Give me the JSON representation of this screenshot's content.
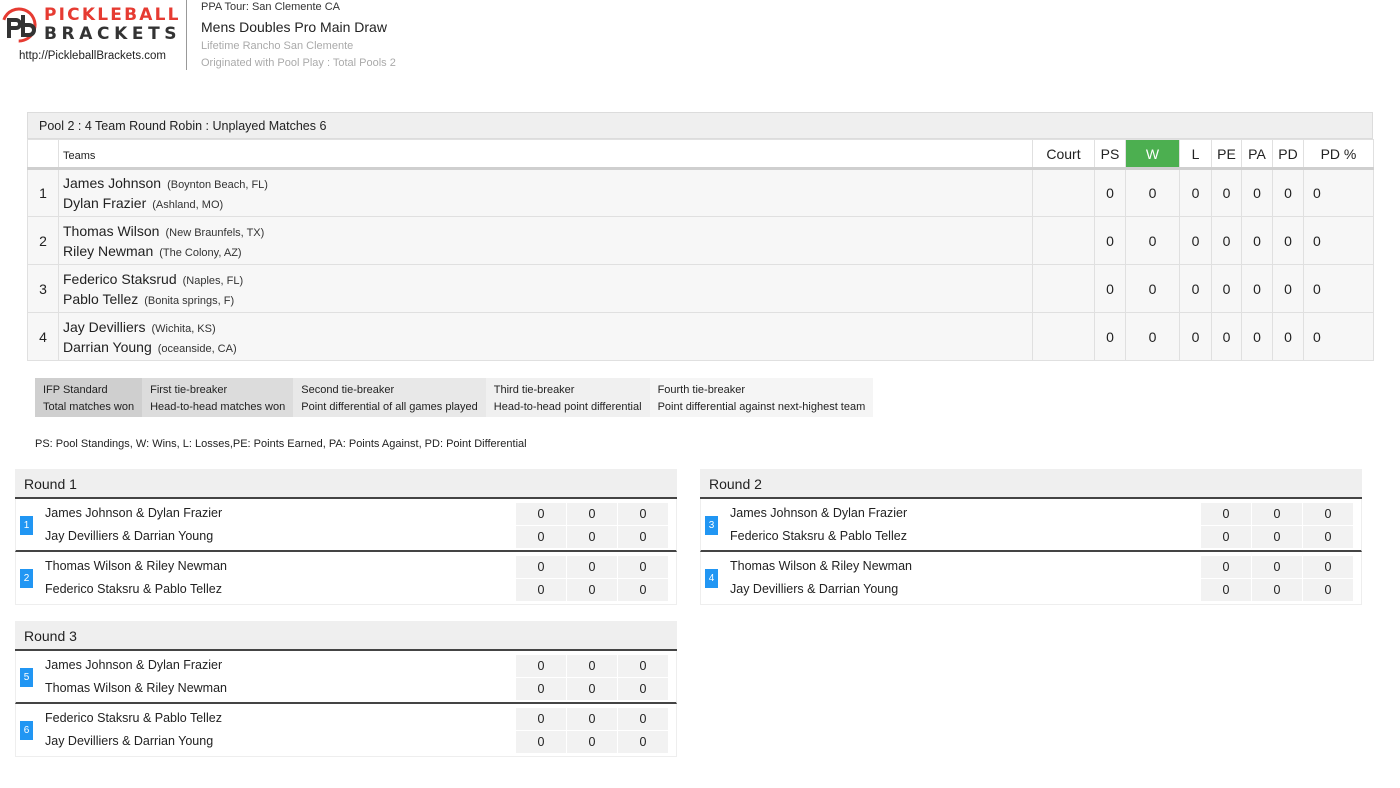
{
  "header": {
    "logo_line1": "PICKLEBALL",
    "logo_line2": "BRACKETS",
    "logo_url": "http://PickleballBrackets.com",
    "tour": "PPA Tour: San Clemente CA",
    "event": "Mens Doubles Pro Main Draw",
    "venue": "Lifetime Rancho San Clemente",
    "origin": "Originated with Pool Play : Total Pools 2"
  },
  "colors": {
    "logo_red": "#e63b32",
    "wins_header": "#4caf50",
    "match_badge": "#2196f3"
  },
  "pool": {
    "title": "Pool 2 : 4 Team Round Robin : Unplayed Matches 6",
    "columns": {
      "teams": "Teams",
      "court": "Court",
      "ps": "PS",
      "w": "W",
      "l": "L",
      "pe": "PE",
      "pa": "PA",
      "pd": "PD",
      "pdpct": "PD %"
    },
    "teams": [
      {
        "rank": "1",
        "p1": "James Johnson",
        "p1_loc": "(Boynton Beach, FL)",
        "p2": "Dylan Frazier",
        "p2_loc": "(Ashland, MO)",
        "court": "",
        "ps": "0",
        "w": "0",
        "l": "0",
        "pe": "0",
        "pa": "0",
        "pd": "0",
        "pdpct": "0"
      },
      {
        "rank": "2",
        "p1": "Thomas Wilson",
        "p1_loc": "(New Braunfels, TX)",
        "p2": "Riley Newman",
        "p2_loc": "(The Colony, AZ)",
        "court": "",
        "ps": "0",
        "w": "0",
        "l": "0",
        "pe": "0",
        "pa": "0",
        "pd": "0",
        "pdpct": "0"
      },
      {
        "rank": "3",
        "p1": "Federico Staksrud",
        "p1_loc": "(Naples, FL)",
        "p2": "Pablo Tellez",
        "p2_loc": "(Bonita springs, F)",
        "court": "",
        "ps": "0",
        "w": "0",
        "l": "0",
        "pe": "0",
        "pa": "0",
        "pd": "0",
        "pdpct": "0"
      },
      {
        "rank": "4",
        "p1": "Jay Devilliers",
        "p1_loc": "(Wichita, KS)",
        "p2": "Darrian Young",
        "p2_loc": "(oceanside, CA)",
        "court": "",
        "ps": "0",
        "w": "0",
        "l": "0",
        "pe": "0",
        "pa": "0",
        "pd": "0",
        "pdpct": "0"
      }
    ]
  },
  "tiebreakers": [
    {
      "label": "IFP Standard",
      "value": "Total matches won"
    },
    {
      "label": "First tie-breaker",
      "value": "Head-to-head matches won"
    },
    {
      "label": "Second tie-breaker",
      "value": "Point differential of all games played"
    },
    {
      "label": "Third tie-breaker",
      "value": "Head-to-head point differential"
    },
    {
      "label": "Fourth tie-breaker",
      "value": "Point differential against next-highest team"
    }
  ],
  "legend": "PS: Pool Standings, W: Wins, L: Losses,PE: Points Earned, PA: Points Against, PD: Point Differential",
  "rounds": [
    {
      "title": "Round 1",
      "matches": [
        {
          "num": "1",
          "team1": "James Johnson & Dylan Frazier",
          "team2": "Jay Devilliers & Darrian Young",
          "scores1": [
            "0",
            "0",
            "0"
          ],
          "scores2": [
            "0",
            "0",
            "0"
          ]
        },
        {
          "num": "2",
          "team1": "Thomas Wilson & Riley Newman",
          "team2": "Federico Staksru & Pablo Tellez",
          "scores1": [
            "0",
            "0",
            "0"
          ],
          "scores2": [
            "0",
            "0",
            "0"
          ]
        }
      ]
    },
    {
      "title": "Round 2",
      "matches": [
        {
          "num": "3",
          "team1": "James Johnson & Dylan Frazier",
          "team2": "Federico Staksru & Pablo Tellez",
          "scores1": [
            "0",
            "0",
            "0"
          ],
          "scores2": [
            "0",
            "0",
            "0"
          ]
        },
        {
          "num": "4",
          "team1": "Thomas Wilson & Riley Newman",
          "team2": "Jay Devilliers & Darrian Young",
          "scores1": [
            "0",
            "0",
            "0"
          ],
          "scores2": [
            "0",
            "0",
            "0"
          ]
        }
      ]
    },
    {
      "title": "Round 3",
      "matches": [
        {
          "num": "5",
          "team1": "James Johnson & Dylan Frazier",
          "team2": "Thomas Wilson & Riley Newman",
          "scores1": [
            "0",
            "0",
            "0"
          ],
          "scores2": [
            "0",
            "0",
            "0"
          ]
        },
        {
          "num": "6",
          "team1": "Federico Staksru & Pablo Tellez",
          "team2": "Jay Devilliers & Darrian Young",
          "scores1": [
            "0",
            "0",
            "0"
          ],
          "scores2": [
            "0",
            "0",
            "0"
          ]
        }
      ]
    }
  ]
}
